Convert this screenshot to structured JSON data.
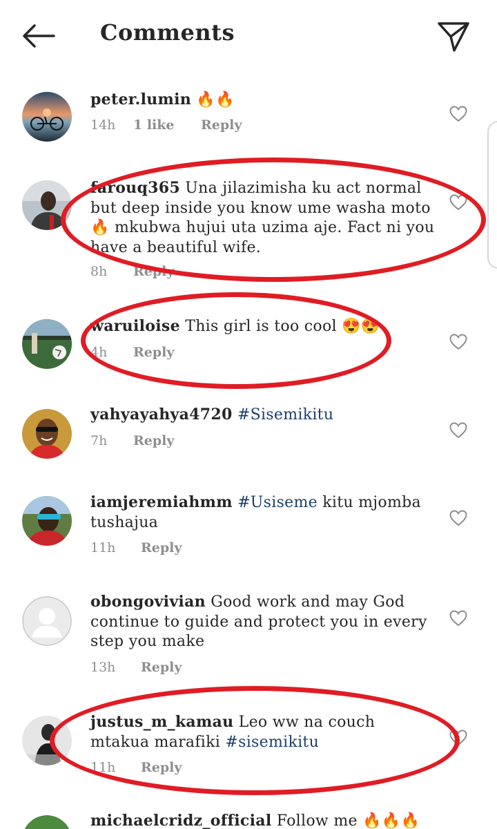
{
  "header": {
    "title": "Comments"
  },
  "comments": [
    {
      "username": "peter.lumin",
      "text": " 🔥🔥",
      "time": "14h",
      "likes": "1 like",
      "reply": "Reply"
    },
    {
      "username": "farouq365",
      "text": " Una jilazimisha ku act normal but deep inside you know ume washa moto 🔥 mkubwa hujui uta uzima aje. Fact ni you have a beautiful wife.",
      "time": "8h",
      "reply": "Reply"
    },
    {
      "username": "waruiloise",
      "text": " This girl is too cool 😍😍",
      "time": "4h",
      "reply": "Reply"
    },
    {
      "username": "yahyayahya4720",
      "tag": " #Sisemikitu",
      "time": "7h",
      "reply": "Reply"
    },
    {
      "username": "iamjeremiahmm",
      "tag": " #Usiseme",
      "text": " kitu mjomba tushajua",
      "time": "11h",
      "reply": "Reply"
    },
    {
      "username": "obongovivian",
      "text": " Good work and may God continue to  guide and protect you in every step you make",
      "time": "13h",
      "reply": "Reply"
    },
    {
      "username": "justus_m_kamau",
      "text": " Leo ww na couch mtakua marafiki ",
      "tag": "#sisemikitu",
      "time": "11h",
      "reply": "Reply"
    },
    {
      "username": "michaelcridz_official",
      "text": " Follow me 🔥🔥🔥"
    }
  ]
}
